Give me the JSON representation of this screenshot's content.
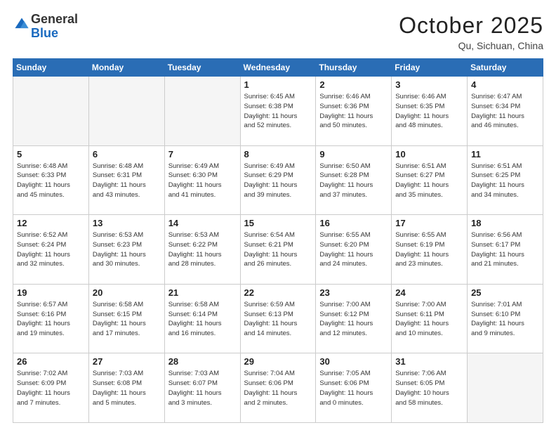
{
  "header": {
    "logo": {
      "general": "General",
      "blue": "Blue"
    },
    "title": "October 2025",
    "location": "Qu, Sichuan, China"
  },
  "days_of_week": [
    "Sunday",
    "Monday",
    "Tuesday",
    "Wednesday",
    "Thursday",
    "Friday",
    "Saturday"
  ],
  "weeks": [
    [
      {
        "day": "",
        "info": ""
      },
      {
        "day": "",
        "info": ""
      },
      {
        "day": "",
        "info": ""
      },
      {
        "day": "1",
        "info": "Sunrise: 6:45 AM\nSunset: 6:38 PM\nDaylight: 11 hours\nand 52 minutes."
      },
      {
        "day": "2",
        "info": "Sunrise: 6:46 AM\nSunset: 6:36 PM\nDaylight: 11 hours\nand 50 minutes."
      },
      {
        "day": "3",
        "info": "Sunrise: 6:46 AM\nSunset: 6:35 PM\nDaylight: 11 hours\nand 48 minutes."
      },
      {
        "day": "4",
        "info": "Sunrise: 6:47 AM\nSunset: 6:34 PM\nDaylight: 11 hours\nand 46 minutes."
      }
    ],
    [
      {
        "day": "5",
        "info": "Sunrise: 6:48 AM\nSunset: 6:33 PM\nDaylight: 11 hours\nand 45 minutes."
      },
      {
        "day": "6",
        "info": "Sunrise: 6:48 AM\nSunset: 6:31 PM\nDaylight: 11 hours\nand 43 minutes."
      },
      {
        "day": "7",
        "info": "Sunrise: 6:49 AM\nSunset: 6:30 PM\nDaylight: 11 hours\nand 41 minutes."
      },
      {
        "day": "8",
        "info": "Sunrise: 6:49 AM\nSunset: 6:29 PM\nDaylight: 11 hours\nand 39 minutes."
      },
      {
        "day": "9",
        "info": "Sunrise: 6:50 AM\nSunset: 6:28 PM\nDaylight: 11 hours\nand 37 minutes."
      },
      {
        "day": "10",
        "info": "Sunrise: 6:51 AM\nSunset: 6:27 PM\nDaylight: 11 hours\nand 35 minutes."
      },
      {
        "day": "11",
        "info": "Sunrise: 6:51 AM\nSunset: 6:25 PM\nDaylight: 11 hours\nand 34 minutes."
      }
    ],
    [
      {
        "day": "12",
        "info": "Sunrise: 6:52 AM\nSunset: 6:24 PM\nDaylight: 11 hours\nand 32 minutes."
      },
      {
        "day": "13",
        "info": "Sunrise: 6:53 AM\nSunset: 6:23 PM\nDaylight: 11 hours\nand 30 minutes."
      },
      {
        "day": "14",
        "info": "Sunrise: 6:53 AM\nSunset: 6:22 PM\nDaylight: 11 hours\nand 28 minutes."
      },
      {
        "day": "15",
        "info": "Sunrise: 6:54 AM\nSunset: 6:21 PM\nDaylight: 11 hours\nand 26 minutes."
      },
      {
        "day": "16",
        "info": "Sunrise: 6:55 AM\nSunset: 6:20 PM\nDaylight: 11 hours\nand 24 minutes."
      },
      {
        "day": "17",
        "info": "Sunrise: 6:55 AM\nSunset: 6:19 PM\nDaylight: 11 hours\nand 23 minutes."
      },
      {
        "day": "18",
        "info": "Sunrise: 6:56 AM\nSunset: 6:17 PM\nDaylight: 11 hours\nand 21 minutes."
      }
    ],
    [
      {
        "day": "19",
        "info": "Sunrise: 6:57 AM\nSunset: 6:16 PM\nDaylight: 11 hours\nand 19 minutes."
      },
      {
        "day": "20",
        "info": "Sunrise: 6:58 AM\nSunset: 6:15 PM\nDaylight: 11 hours\nand 17 minutes."
      },
      {
        "day": "21",
        "info": "Sunrise: 6:58 AM\nSunset: 6:14 PM\nDaylight: 11 hours\nand 16 minutes."
      },
      {
        "day": "22",
        "info": "Sunrise: 6:59 AM\nSunset: 6:13 PM\nDaylight: 11 hours\nand 14 minutes."
      },
      {
        "day": "23",
        "info": "Sunrise: 7:00 AM\nSunset: 6:12 PM\nDaylight: 11 hours\nand 12 minutes."
      },
      {
        "day": "24",
        "info": "Sunrise: 7:00 AM\nSunset: 6:11 PM\nDaylight: 11 hours\nand 10 minutes."
      },
      {
        "day": "25",
        "info": "Sunrise: 7:01 AM\nSunset: 6:10 PM\nDaylight: 11 hours\nand 9 minutes."
      }
    ],
    [
      {
        "day": "26",
        "info": "Sunrise: 7:02 AM\nSunset: 6:09 PM\nDaylight: 11 hours\nand 7 minutes."
      },
      {
        "day": "27",
        "info": "Sunrise: 7:03 AM\nSunset: 6:08 PM\nDaylight: 11 hours\nand 5 minutes."
      },
      {
        "day": "28",
        "info": "Sunrise: 7:03 AM\nSunset: 6:07 PM\nDaylight: 11 hours\nand 3 minutes."
      },
      {
        "day": "29",
        "info": "Sunrise: 7:04 AM\nSunset: 6:06 PM\nDaylight: 11 hours\nand 2 minutes."
      },
      {
        "day": "30",
        "info": "Sunrise: 7:05 AM\nSunset: 6:06 PM\nDaylight: 11 hours\nand 0 minutes."
      },
      {
        "day": "31",
        "info": "Sunrise: 7:06 AM\nSunset: 6:05 PM\nDaylight: 10 hours\nand 58 minutes."
      },
      {
        "day": "",
        "info": ""
      }
    ]
  ]
}
